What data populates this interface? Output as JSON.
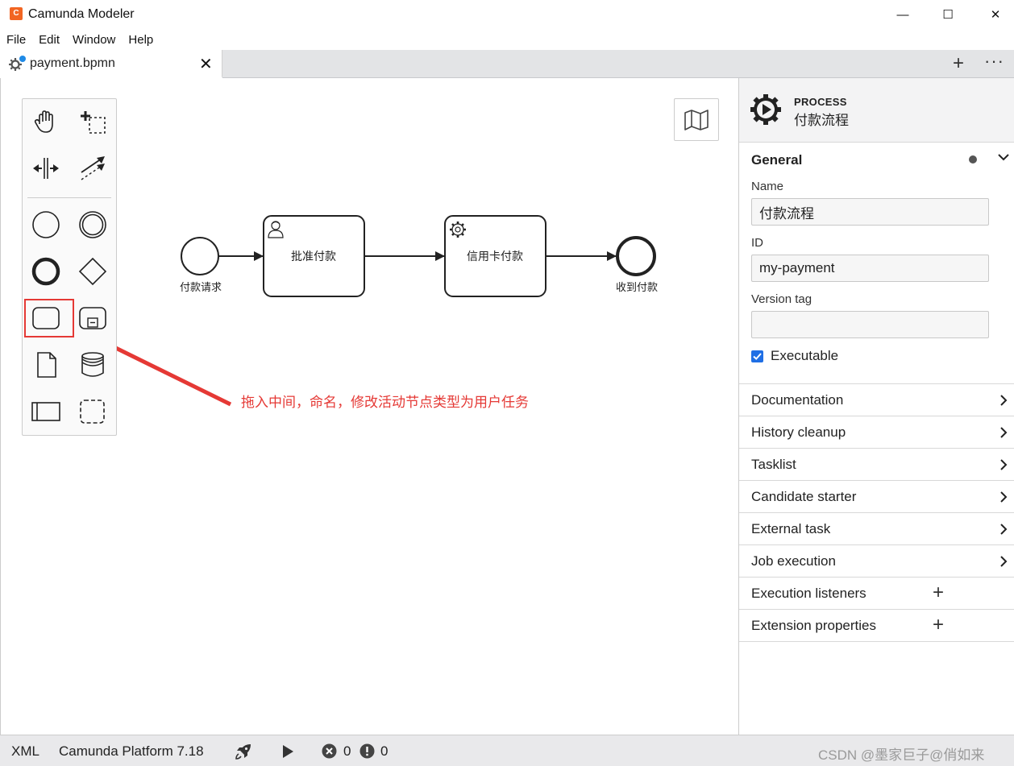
{
  "window": {
    "app_icon": "camunda-logo-icon",
    "title": "Camunda Modeler",
    "minimize": "—",
    "maximize": "☐",
    "close": "✕"
  },
  "menu": [
    "File",
    "Edit",
    "Window",
    "Help"
  ],
  "tabs": [
    {
      "label": "payment.bpmn",
      "icon": "bpmn-gear-icon",
      "unsaved_dot_color": "#1f8ae6",
      "close": "✕"
    }
  ],
  "tabbar": {
    "add": "+",
    "more": "···"
  },
  "palette": {
    "tools": [
      "hand-tool",
      "lasso-tool",
      "space-tool",
      "connect-tool",
      "start-event",
      "intermediate-event",
      "end-event",
      "gateway",
      "task",
      "subprocess",
      "data-object",
      "data-store",
      "pool",
      "group"
    ],
    "highlighted_tool": "task",
    "highlight_color": "#e53935"
  },
  "diagram": {
    "start_event_label": "付款请求",
    "task1_label": "批准付款",
    "task1_type": "user-task-icon",
    "task2_label": "信用卡付款",
    "task2_type": "service-task-icon",
    "end_event_label": "收到付款"
  },
  "annotation": {
    "text": "拖入中间，命名，修改活动节点类型为用户任务",
    "color": "#e53935"
  },
  "properties": {
    "header": {
      "type": "PROCESS",
      "name": "付款流程"
    },
    "general": {
      "title": "General",
      "name_label": "Name",
      "name_value": "付款流程",
      "id_label": "ID",
      "id_value": "my-payment",
      "version_label": "Version tag",
      "version_value": "",
      "executable_label": "Executable",
      "executable_checked": true
    },
    "groups": [
      {
        "label": "Documentation",
        "action": "chevron"
      },
      {
        "label": "History cleanup",
        "action": "chevron"
      },
      {
        "label": "Tasklist",
        "action": "chevron"
      },
      {
        "label": "Candidate starter",
        "action": "chevron"
      },
      {
        "label": "External task",
        "action": "chevron"
      },
      {
        "label": "Job execution",
        "action": "chevron"
      },
      {
        "label": "Execution listeners",
        "action": "plus"
      },
      {
        "label": "Extension properties",
        "action": "plus"
      }
    ],
    "plus": "+"
  },
  "status": {
    "xml": "XML",
    "platform": "Camunda Platform 7.18",
    "errors": "0",
    "warnings": "0",
    "watermark": "CSDN @墨家巨子@俏如来"
  }
}
